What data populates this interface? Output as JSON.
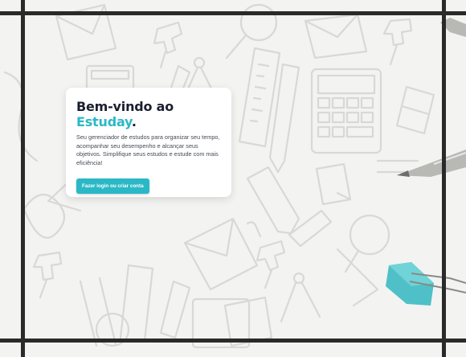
{
  "hero": {
    "title_line1": "Bem-vindo ao",
    "brand": "Estuday",
    "brand_suffix": ".",
    "description": "Seu gerenciador de estudos para organizar seu tempo, acompanhar seu desempenho e alcançar seus objetivos. Simplifique seus estudos e estude com mais eficiência!",
    "cta_label": "Fazer login ou criar conta"
  },
  "colors": {
    "accent": "#2bb8c6",
    "title": "#1a1f2e",
    "frame": "#2a2a2a",
    "background": "#f3f3f2"
  },
  "decor": [
    "pushpin-icon",
    "compass-icon",
    "ruler-icon",
    "pencil-icon",
    "calculator-icon",
    "eraser-icon",
    "envelope-icon",
    "magnifier-icon",
    "paperclip-icon",
    "pen-icon",
    "binder-clip-icon"
  ]
}
